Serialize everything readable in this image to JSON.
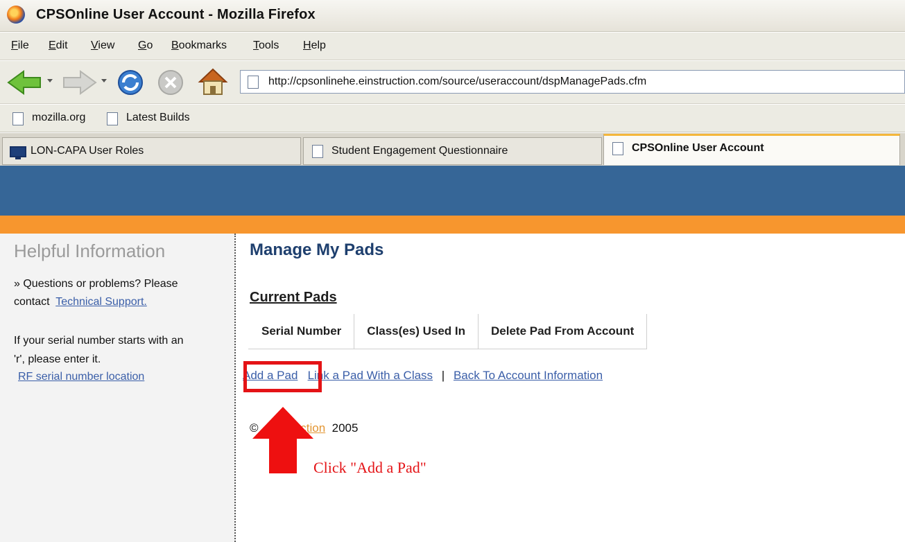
{
  "window": {
    "title": "CPSOnline User Account - Mozilla Firefox"
  },
  "menubar": {
    "items": [
      {
        "key": "F",
        "rest": "ile"
      },
      {
        "key": "E",
        "rest": "dit"
      },
      {
        "key": "V",
        "rest": "iew"
      },
      {
        "key": "G",
        "rest": "o"
      },
      {
        "key": "B",
        "rest": "ookmarks"
      },
      {
        "key": "T",
        "rest": "ools"
      },
      {
        "key": "H",
        "rest": "elp"
      }
    ]
  },
  "toolbar": {
    "url": "http://cpsonlinehe.einstruction.com/source/useraccount/dspManagePads.cfm",
    "icons": [
      "back-icon",
      "forward-icon",
      "reload-icon",
      "stop-icon",
      "home-icon"
    ]
  },
  "bookmarks": [
    "mozilla.org",
    "Latest Builds"
  ],
  "tabs": [
    {
      "label": "LON-CAPA User Roles",
      "active": false
    },
    {
      "label": "Student Engagement Questionnaire",
      "active": false
    },
    {
      "label": "CPSOnline User Account",
      "active": true
    }
  ],
  "sidebar": {
    "title": "Helpful Information",
    "line1": "» Questions or problems? Please",
    "line2_prefix": "contact",
    "support_link": "Technical Support.",
    "line3": "If your serial number starts with an",
    "line4": "'r', please enter it.",
    "rf_link": "RF serial number location"
  },
  "main": {
    "title": "Manage My Pads",
    "section": "Current Pads",
    "columns": [
      "Serial Number",
      "Class(es) Used In",
      "Delete Pad From Account"
    ],
    "actions": {
      "add": "Add a Pad",
      "link": "Link a Pad With a Class",
      "separator": "|",
      "back": "Back To Account Information"
    },
    "copyright": {
      "symbol": "©",
      "company_visible": "ction",
      "year": "2005"
    }
  },
  "annotation": {
    "callout": "Click \"Add a Pad\"",
    "color": "#e41316"
  },
  "colors": {
    "banner": "#366697",
    "stripe": "#f7962e",
    "link": "#3a5ea8"
  }
}
